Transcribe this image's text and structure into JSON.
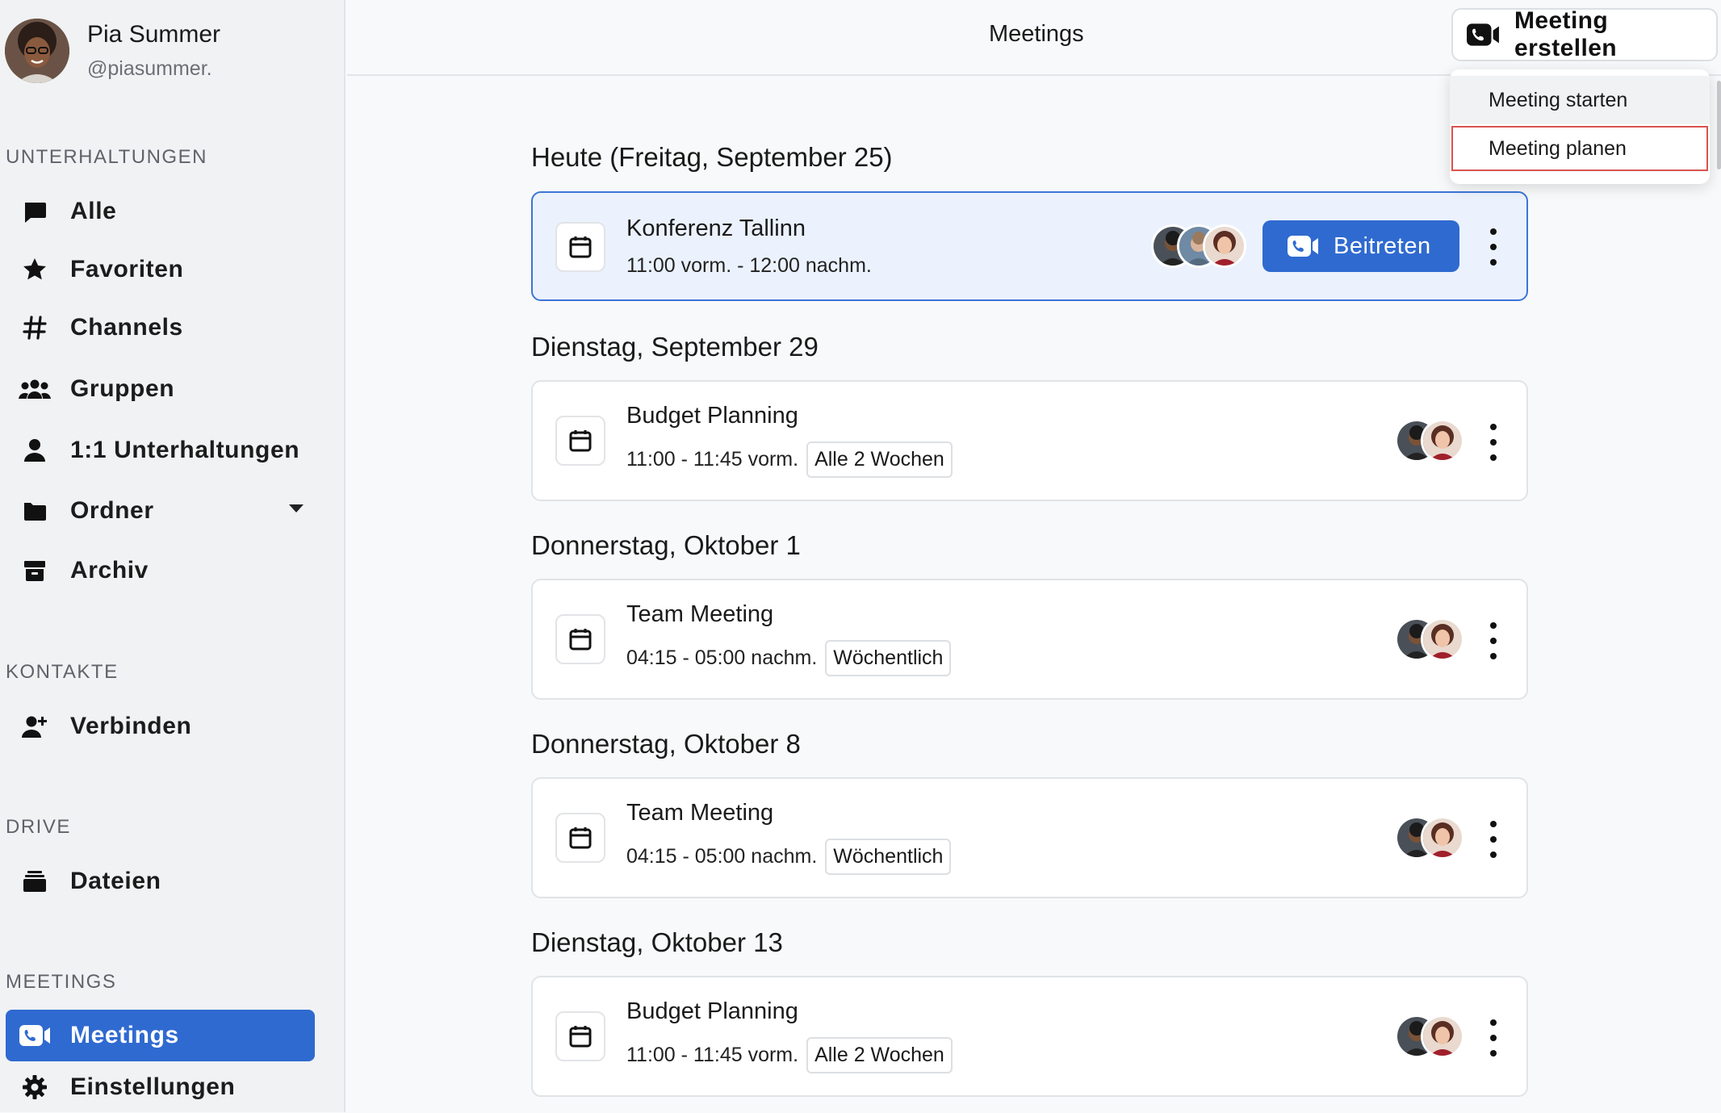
{
  "profile": {
    "name": "Pia Summer",
    "handle": "@piasummer."
  },
  "sidebar": {
    "conversations_title": "UNTERHALTUNGEN",
    "conversations": [
      {
        "label": "Alle",
        "icon": "chat-bubble-icon"
      },
      {
        "label": "Favoriten",
        "icon": "star-icon"
      },
      {
        "label": "Channels",
        "icon": "hash-icon"
      },
      {
        "label": "Gruppen",
        "icon": "group-icon"
      },
      {
        "label": "1:1 Unterhaltungen",
        "icon": "person-icon"
      },
      {
        "label": "Ordner",
        "icon": "folder-icon"
      },
      {
        "label": "Archiv",
        "icon": "archive-icon"
      }
    ],
    "contacts_title": "KONTAKTE",
    "contacts": [
      {
        "label": "Verbinden",
        "icon": "add-person-icon"
      }
    ],
    "drive_title": "DRIVE",
    "drive": [
      {
        "label": "Dateien",
        "icon": "files-icon"
      }
    ],
    "meetings_title": "MEETINGS",
    "meetings": [
      {
        "label": "Meetings",
        "icon": "video-camera-icon",
        "active": true
      },
      {
        "label": "Einstellungen",
        "icon": "gear-icon"
      }
    ]
  },
  "header": {
    "title": "Meetings",
    "create_label": "Meeting erstellen"
  },
  "dropdown": {
    "items": [
      "Meeting starten",
      "Meeting planen"
    ]
  },
  "days": [
    {
      "heading": "Heute (Freitag, September 25)"
    },
    {
      "heading": "Dienstag, September 29"
    },
    {
      "heading": "Donnerstag, Oktober 1"
    },
    {
      "heading": "Donnerstag, Oktober 8"
    },
    {
      "heading": "Dienstag, Oktober 13"
    }
  ],
  "meetings": [
    {
      "title": "Konferenz Tallinn",
      "time": "11:00 vorm. - 12:00 nachm.",
      "recurrence": "",
      "join_label": "Beitreten",
      "participants": 3
    },
    {
      "title": "Budget Planning",
      "time": "11:00 - 11:45 vorm.",
      "recurrence": "Alle 2 Wochen",
      "participants": 2
    },
    {
      "title": "Team Meeting",
      "time": "04:15 - 05:00 nachm.",
      "recurrence": "Wöchentlich",
      "participants": 2
    },
    {
      "title": "Team Meeting",
      "time": "04:15 - 05:00 nachm.",
      "recurrence": "Wöchentlich",
      "participants": 2
    },
    {
      "title": "Budget Planning",
      "time": "11:00 - 11:45 vorm.",
      "recurrence": "Alle 2 Wochen",
      "participants": 2
    }
  ],
  "colors": {
    "accent": "#2f6ad0",
    "today_bg": "#ebf2fd",
    "highlight_outline": "#d9534f"
  }
}
